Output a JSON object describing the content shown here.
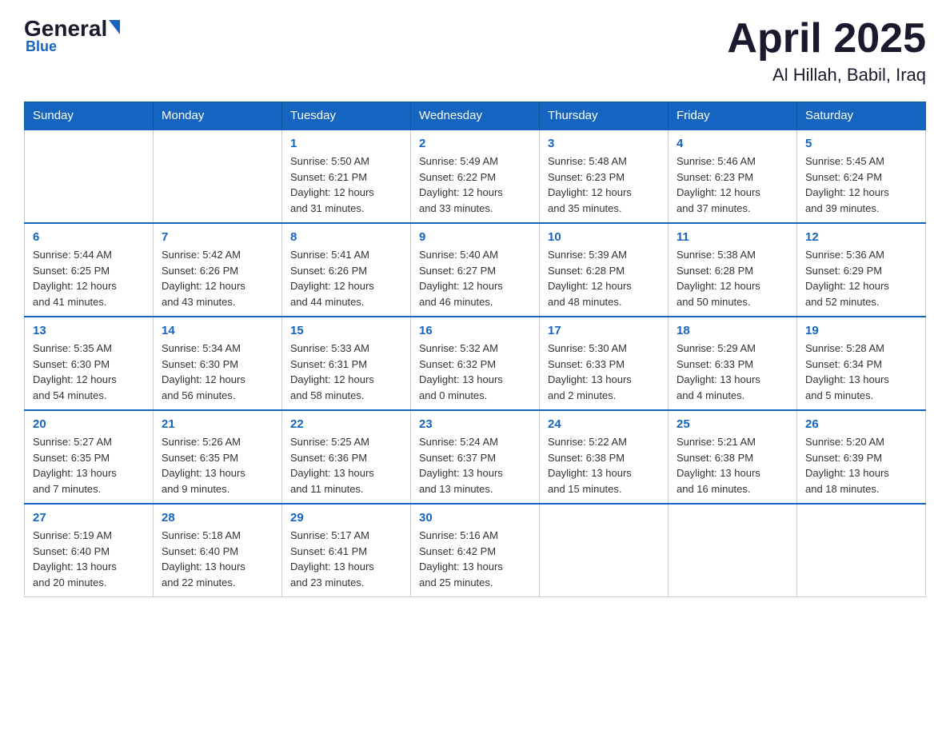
{
  "header": {
    "logo_general": "General",
    "logo_blue": "Blue",
    "month": "April 2025",
    "location": "Al Hillah, Babil, Iraq"
  },
  "days_of_week": [
    "Sunday",
    "Monday",
    "Tuesday",
    "Wednesday",
    "Thursday",
    "Friday",
    "Saturday"
  ],
  "weeks": [
    [
      {
        "day": "",
        "info": ""
      },
      {
        "day": "",
        "info": ""
      },
      {
        "day": "1",
        "info": "Sunrise: 5:50 AM\nSunset: 6:21 PM\nDaylight: 12 hours\nand 31 minutes."
      },
      {
        "day": "2",
        "info": "Sunrise: 5:49 AM\nSunset: 6:22 PM\nDaylight: 12 hours\nand 33 minutes."
      },
      {
        "day": "3",
        "info": "Sunrise: 5:48 AM\nSunset: 6:23 PM\nDaylight: 12 hours\nand 35 minutes."
      },
      {
        "day": "4",
        "info": "Sunrise: 5:46 AM\nSunset: 6:23 PM\nDaylight: 12 hours\nand 37 minutes."
      },
      {
        "day": "5",
        "info": "Sunrise: 5:45 AM\nSunset: 6:24 PM\nDaylight: 12 hours\nand 39 minutes."
      }
    ],
    [
      {
        "day": "6",
        "info": "Sunrise: 5:44 AM\nSunset: 6:25 PM\nDaylight: 12 hours\nand 41 minutes."
      },
      {
        "day": "7",
        "info": "Sunrise: 5:42 AM\nSunset: 6:26 PM\nDaylight: 12 hours\nand 43 minutes."
      },
      {
        "day": "8",
        "info": "Sunrise: 5:41 AM\nSunset: 6:26 PM\nDaylight: 12 hours\nand 44 minutes."
      },
      {
        "day": "9",
        "info": "Sunrise: 5:40 AM\nSunset: 6:27 PM\nDaylight: 12 hours\nand 46 minutes."
      },
      {
        "day": "10",
        "info": "Sunrise: 5:39 AM\nSunset: 6:28 PM\nDaylight: 12 hours\nand 48 minutes."
      },
      {
        "day": "11",
        "info": "Sunrise: 5:38 AM\nSunset: 6:28 PM\nDaylight: 12 hours\nand 50 minutes."
      },
      {
        "day": "12",
        "info": "Sunrise: 5:36 AM\nSunset: 6:29 PM\nDaylight: 12 hours\nand 52 minutes."
      }
    ],
    [
      {
        "day": "13",
        "info": "Sunrise: 5:35 AM\nSunset: 6:30 PM\nDaylight: 12 hours\nand 54 minutes."
      },
      {
        "day": "14",
        "info": "Sunrise: 5:34 AM\nSunset: 6:30 PM\nDaylight: 12 hours\nand 56 minutes."
      },
      {
        "day": "15",
        "info": "Sunrise: 5:33 AM\nSunset: 6:31 PM\nDaylight: 12 hours\nand 58 minutes."
      },
      {
        "day": "16",
        "info": "Sunrise: 5:32 AM\nSunset: 6:32 PM\nDaylight: 13 hours\nand 0 minutes."
      },
      {
        "day": "17",
        "info": "Sunrise: 5:30 AM\nSunset: 6:33 PM\nDaylight: 13 hours\nand 2 minutes."
      },
      {
        "day": "18",
        "info": "Sunrise: 5:29 AM\nSunset: 6:33 PM\nDaylight: 13 hours\nand 4 minutes."
      },
      {
        "day": "19",
        "info": "Sunrise: 5:28 AM\nSunset: 6:34 PM\nDaylight: 13 hours\nand 5 minutes."
      }
    ],
    [
      {
        "day": "20",
        "info": "Sunrise: 5:27 AM\nSunset: 6:35 PM\nDaylight: 13 hours\nand 7 minutes."
      },
      {
        "day": "21",
        "info": "Sunrise: 5:26 AM\nSunset: 6:35 PM\nDaylight: 13 hours\nand 9 minutes."
      },
      {
        "day": "22",
        "info": "Sunrise: 5:25 AM\nSunset: 6:36 PM\nDaylight: 13 hours\nand 11 minutes."
      },
      {
        "day": "23",
        "info": "Sunrise: 5:24 AM\nSunset: 6:37 PM\nDaylight: 13 hours\nand 13 minutes."
      },
      {
        "day": "24",
        "info": "Sunrise: 5:22 AM\nSunset: 6:38 PM\nDaylight: 13 hours\nand 15 minutes."
      },
      {
        "day": "25",
        "info": "Sunrise: 5:21 AM\nSunset: 6:38 PM\nDaylight: 13 hours\nand 16 minutes."
      },
      {
        "day": "26",
        "info": "Sunrise: 5:20 AM\nSunset: 6:39 PM\nDaylight: 13 hours\nand 18 minutes."
      }
    ],
    [
      {
        "day": "27",
        "info": "Sunrise: 5:19 AM\nSunset: 6:40 PM\nDaylight: 13 hours\nand 20 minutes."
      },
      {
        "day": "28",
        "info": "Sunrise: 5:18 AM\nSunset: 6:40 PM\nDaylight: 13 hours\nand 22 minutes."
      },
      {
        "day": "29",
        "info": "Sunrise: 5:17 AM\nSunset: 6:41 PM\nDaylight: 13 hours\nand 23 minutes."
      },
      {
        "day": "30",
        "info": "Sunrise: 5:16 AM\nSunset: 6:42 PM\nDaylight: 13 hours\nand 25 minutes."
      },
      {
        "day": "",
        "info": ""
      },
      {
        "day": "",
        "info": ""
      },
      {
        "day": "",
        "info": ""
      }
    ]
  ]
}
